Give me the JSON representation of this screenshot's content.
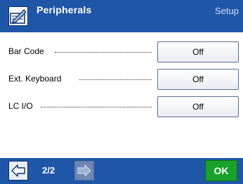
{
  "header": {
    "title": "Peripherals",
    "breadcrumb": "Setup",
    "icon": "peripherals-icon",
    "background_color": "#1f56a8"
  },
  "settings": [
    {
      "label": "Bar Code",
      "value": "Off"
    },
    {
      "label": "Ext. Keyboard",
      "value": "Off"
    },
    {
      "label": "LC I/O",
      "value": "Off"
    }
  ],
  "footer": {
    "page_indicator": "2/2",
    "prev_icon": "arrow-left-icon",
    "next_icon": "arrow-right-icon",
    "next_enabled": false,
    "ok_label": "OK",
    "ok_color": "#17a22a"
  }
}
